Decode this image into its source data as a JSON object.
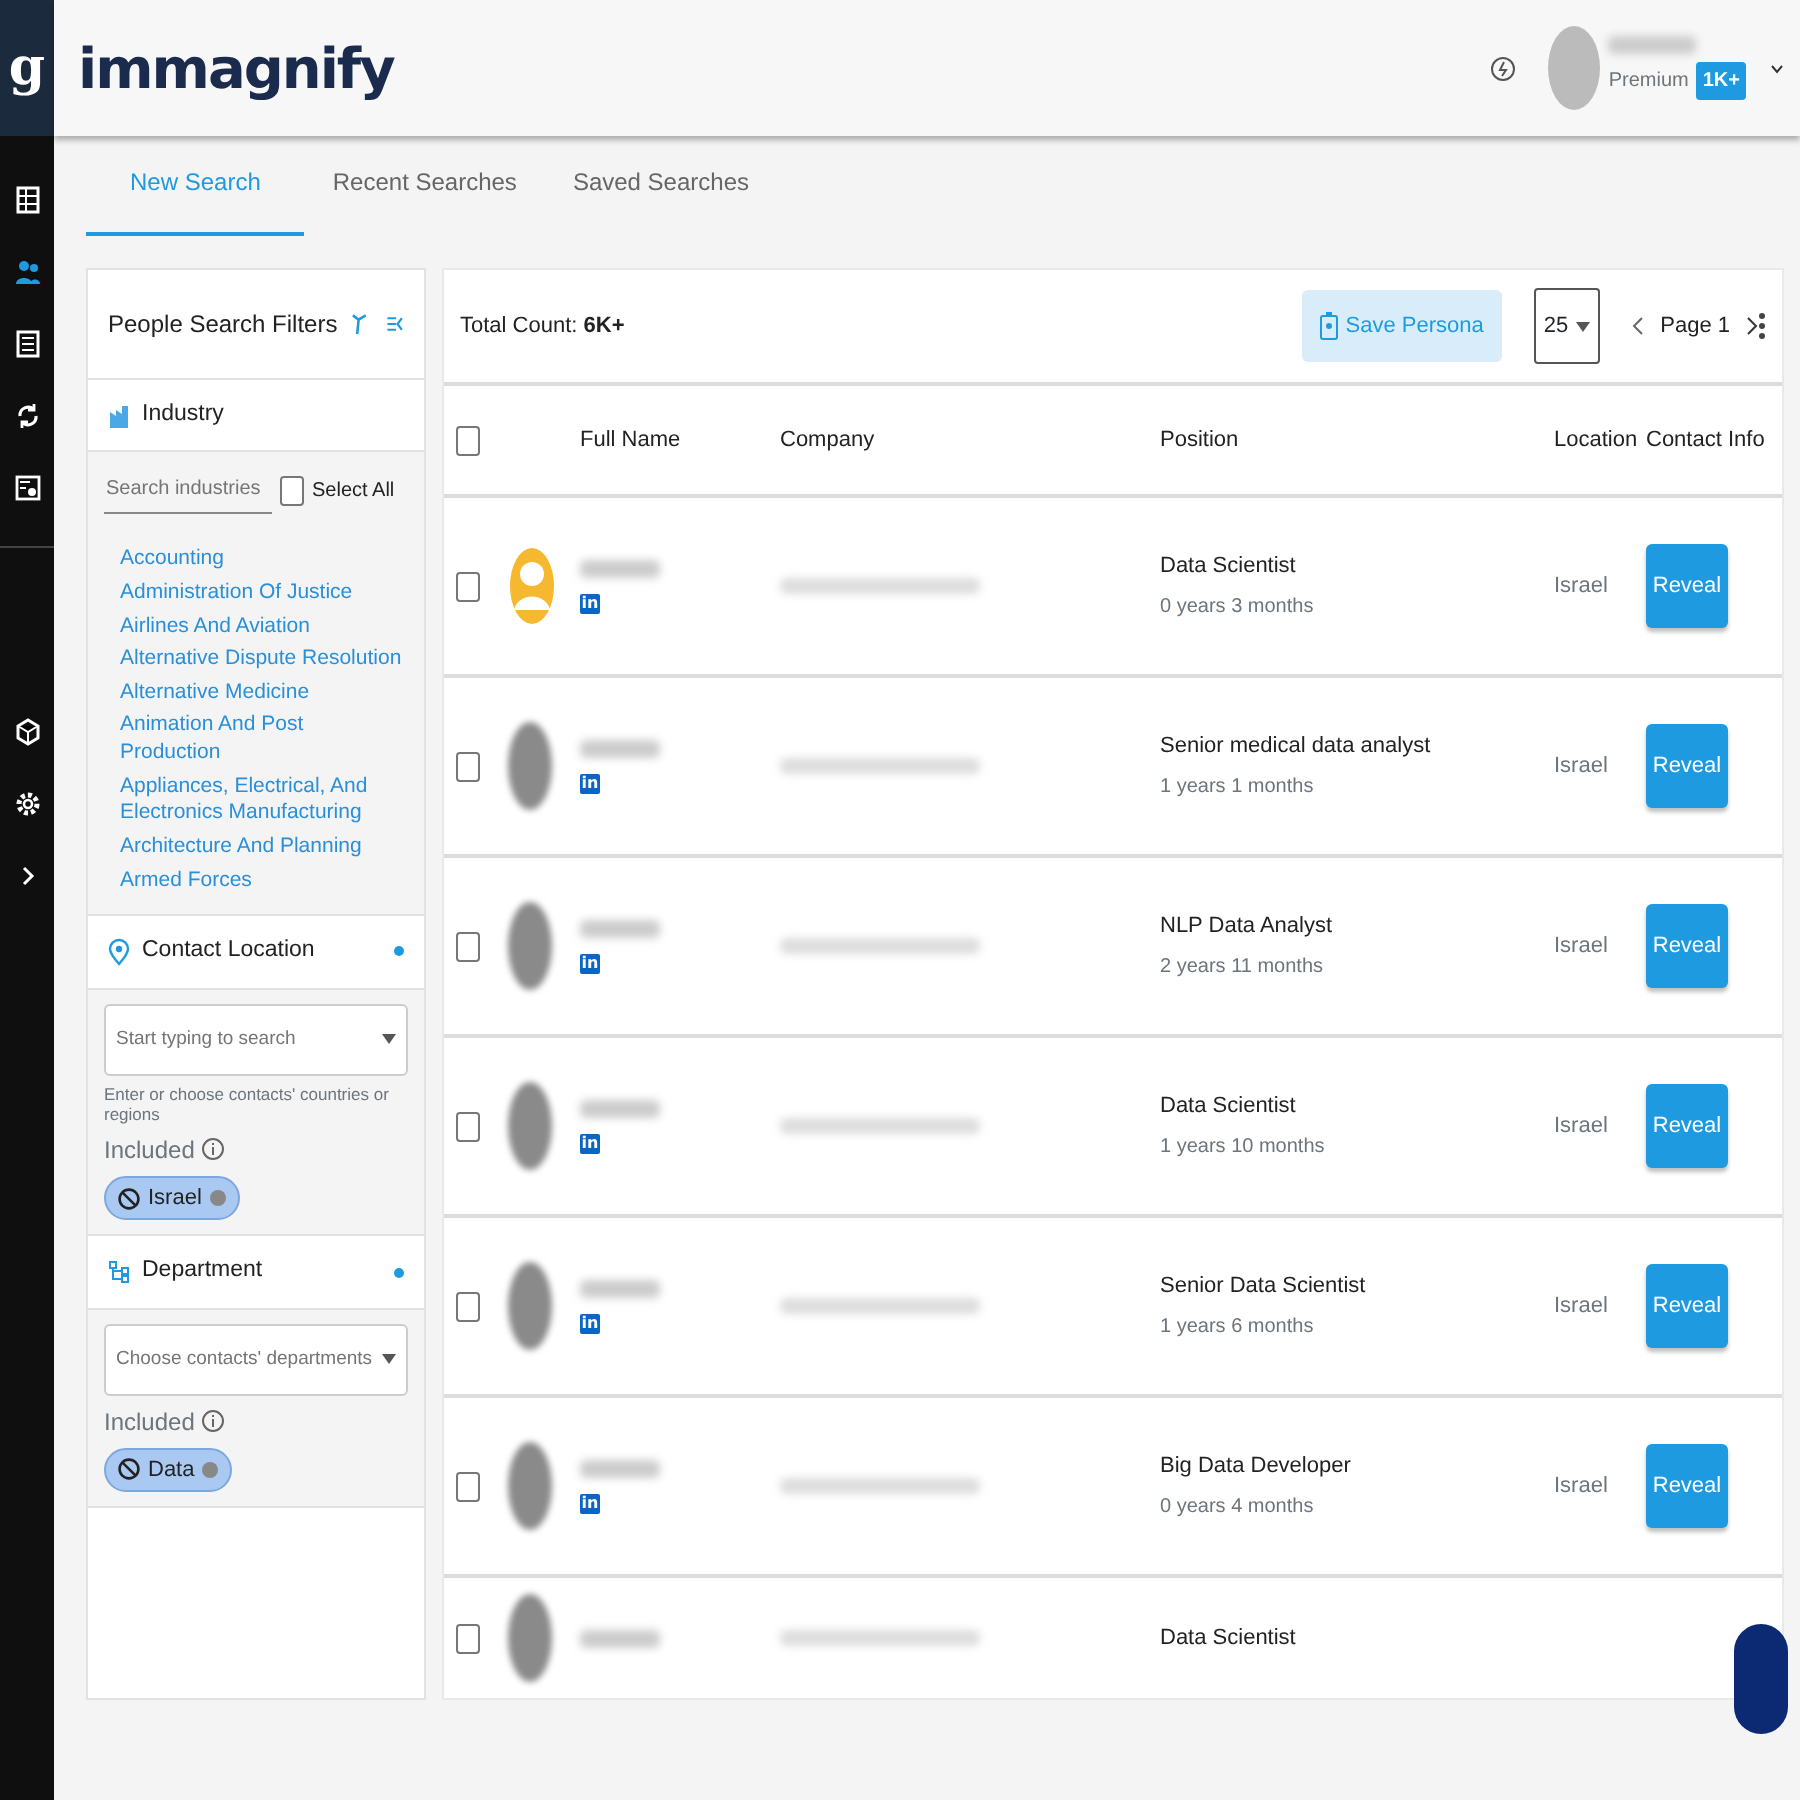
{
  "app": {
    "logo_letter": "g",
    "brand": "immagnify"
  },
  "sidebar": {
    "items": [
      {
        "kind": "table",
        "selected": false
      },
      {
        "kind": "people",
        "selected": true
      },
      {
        "kind": "list",
        "selected": false
      },
      {
        "kind": "sync",
        "selected": false
      },
      {
        "kind": "card",
        "selected": false
      },
      {
        "kind": "box",
        "selected": false
      },
      {
        "kind": "gear",
        "selected": false
      },
      {
        "kind": "chevron",
        "selected": false
      }
    ]
  },
  "header": {
    "plan": "Premium",
    "credits": "1K+"
  },
  "tabs": [
    {
      "label": "New Search",
      "selected": true
    },
    {
      "label": "Recent Searches",
      "selected": false
    },
    {
      "label": "Saved Searches",
      "selected": false
    }
  ],
  "filters": {
    "title": "People Search Filters",
    "industry": {
      "title": "Industry",
      "placeholder": "Search industries",
      "select_all": {
        "label": "Select All",
        "checked": false
      },
      "items": [
        "Accounting",
        "Administration Of Justice",
        "Airlines And Aviation",
        "Alternative Dispute Resolution",
        "Alternative Medicine",
        "Animation And Post Production",
        "Appliances, Electrical, And Electronics Manufacturing",
        "Architecture And Planning",
        "Armed Forces"
      ]
    },
    "sections": [
      {
        "kind": "location",
        "title": "Contact Location",
        "active": true,
        "placeholder": "Start typing to search",
        "hint": "Enter or choose contacts' countries or regions",
        "included_label": "Included",
        "chips": [
          "Israel"
        ]
      },
      {
        "kind": "department",
        "title": "Department",
        "active": true,
        "placeholder": "Choose contacts' departments",
        "included_label": "Included",
        "chips": [
          "Data"
        ]
      }
    ]
  },
  "results": {
    "total_label": "Total Count:",
    "total": "6K+",
    "save_label": "Save Persona",
    "per_page": "25",
    "page": "Page 1",
    "select_all_checked": false,
    "columns": [
      "Full Name",
      "Company",
      "Position",
      "Location",
      "Contact Info"
    ],
    "rows": [
      {
        "kind": "default",
        "checked": false,
        "social": "in",
        "position": "Data Scientist",
        "tenure": "0 years 3 months",
        "location": "Israel",
        "action": "Reveal"
      },
      {
        "kind": "photo",
        "checked": false,
        "social": "in",
        "position": "Senior medical data analyst",
        "tenure": "1 years 1 months",
        "location": "Israel",
        "action": "Reveal"
      },
      {
        "kind": "photo",
        "checked": false,
        "social": "in",
        "position": "NLP Data Analyst",
        "tenure": "2 years 11 months",
        "location": "Israel",
        "action": "Reveal"
      },
      {
        "kind": "photo",
        "checked": false,
        "social": "in",
        "position": "Data Scientist",
        "tenure": "1 years 10 months",
        "location": "Israel",
        "action": "Reveal"
      },
      {
        "kind": "photo",
        "checked": false,
        "social": "in",
        "position": "Senior Data Scientist",
        "tenure": "1 years 6 months",
        "location": "Israel",
        "action": "Reveal"
      },
      {
        "kind": "photo",
        "checked": false,
        "social": "in",
        "position": "Big Data Developer",
        "tenure": "0 years 4 months",
        "location": "Israel",
        "action": "Reveal"
      },
      {
        "kind": "photo",
        "checked": false,
        "position": "Data Scientist"
      }
    ]
  }
}
